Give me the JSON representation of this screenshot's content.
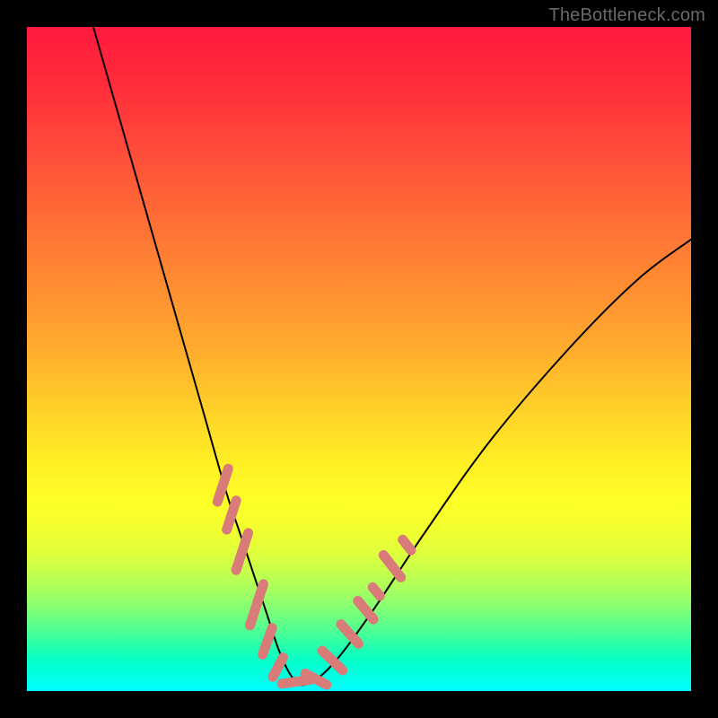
{
  "watermark": "TheBottleneck.com",
  "chart_data": {
    "type": "line",
    "title": "",
    "xlabel": "",
    "ylabel": "",
    "xlim": [
      0,
      100
    ],
    "ylim": [
      0,
      100
    ],
    "grid": false,
    "series": [
      {
        "name": "bottleneck-curve",
        "x": [
          10,
          14,
          18,
          22,
          26,
          30,
          32,
          34,
          36,
          38,
          40,
          42,
          46,
          52,
          60,
          70,
          82,
          92,
          100
        ],
        "y": [
          100,
          86,
          72,
          58,
          44,
          30,
          24,
          18,
          12,
          6,
          2,
          1,
          4,
          12,
          24,
          38,
          52,
          62,
          68
        ]
      }
    ],
    "markers": {
      "name": "highlighted-range",
      "color": "#d97b78",
      "clusters": [
        {
          "cx": 29.5,
          "cy": 31.0,
          "angle_deg": 72,
          "len": 4.2
        },
        {
          "cx": 30.8,
          "cy": 26.5,
          "angle_deg": 72,
          "len": 3.8
        },
        {
          "cx": 32.4,
          "cy": 21.0,
          "angle_deg": 72,
          "len": 4.6
        },
        {
          "cx": 34.6,
          "cy": 13.0,
          "angle_deg": 72,
          "len": 5.0
        },
        {
          "cx": 36.2,
          "cy": 7.5,
          "angle_deg": 70,
          "len": 3.6
        },
        {
          "cx": 37.8,
          "cy": 3.6,
          "angle_deg": 62,
          "len": 3.0
        },
        {
          "cx": 40.5,
          "cy": 1.4,
          "angle_deg": 8,
          "len": 3.6
        },
        {
          "cx": 43.5,
          "cy": 1.8,
          "angle_deg": -28,
          "len": 3.2
        },
        {
          "cx": 46.0,
          "cy": 4.6,
          "angle_deg": -44,
          "len": 3.6
        },
        {
          "cx": 48.6,
          "cy": 8.6,
          "angle_deg": -48,
          "len": 3.4
        },
        {
          "cx": 51.0,
          "cy": 12.2,
          "angle_deg": -50,
          "len": 3.2
        },
        {
          "cx": 52.6,
          "cy": 15.0,
          "angle_deg": -50,
          "len": 2.0
        },
        {
          "cx": 55.0,
          "cy": 18.8,
          "angle_deg": -52,
          "len": 3.6
        },
        {
          "cx": 57.2,
          "cy": 22.0,
          "angle_deg": -52,
          "len": 2.2
        }
      ]
    },
    "background": {
      "type": "vertical-gradient",
      "stops": [
        {
          "pos": 0.0,
          "color": "#ff1a3e"
        },
        {
          "pos": 0.5,
          "color": "#ffb82a"
        },
        {
          "pos": 0.72,
          "color": "#fdff28"
        },
        {
          "pos": 0.9,
          "color": "#4cff94"
        },
        {
          "pos": 1.0,
          "color": "#02f8ff"
        }
      ]
    }
  }
}
